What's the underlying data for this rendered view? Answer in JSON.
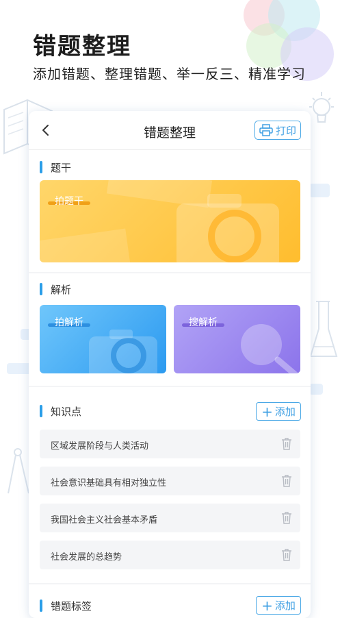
{
  "hero": {
    "title": "错题整理",
    "subtitle": "添加错题、整理错题、举一反三、精准学习"
  },
  "nav": {
    "title": "错题整理",
    "print_label": "打印"
  },
  "sections": {
    "stem": {
      "title": "题干",
      "card_label": "拍题干"
    },
    "analysis": {
      "title": "解析",
      "photo_label": "拍解析",
      "search_label": "搜解析"
    },
    "knowledge": {
      "title": "知识点",
      "add_label": "添加",
      "items": [
        "区域发展阶段与人类活动",
        "社会意识基础具有相对独立性",
        "我国社会主义社会基本矛盾",
        "社会发展的总趋势"
      ]
    },
    "tags": {
      "title": "错题标签",
      "add_label": "添加"
    }
  },
  "colors": {
    "accent": "#2b9ee8",
    "stem_card": "#ffc240",
    "photo_card": "#3aa8f2",
    "search_card": "#9a86ee"
  }
}
